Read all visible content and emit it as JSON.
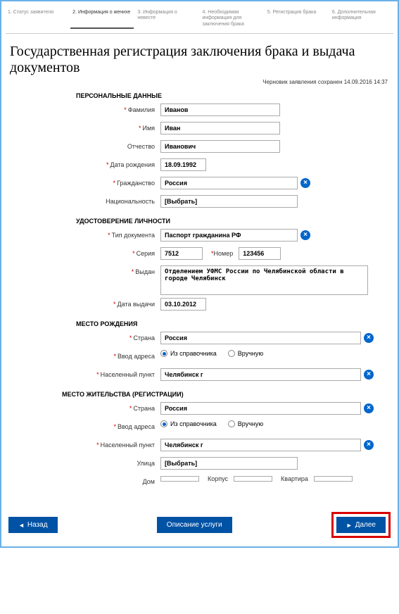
{
  "steps": [
    "1. Статус заявителя",
    "2. Информация о женихе",
    "3. Информация о невесте",
    "4. Необходимая информация для заключения брака",
    "5. Регистрация брака",
    "6. Дополнительная информация"
  ],
  "title": "Государственная регистрация заключения брака и выдача документов",
  "saved": "Черновик заявления сохранен 14.09.2016 14:37",
  "sections": {
    "personal": "ПЕРСОНАЛЬНЫЕ ДАННЫЕ",
    "identity": "УДОСТОВЕРЕНИЕ ЛИЧНОСТИ",
    "birthplace": "МЕСТО РОЖДЕНИЯ",
    "residence": "МЕСТО ЖИТЕЛЬСТВА (РЕГИСТРАЦИИ)"
  },
  "labels": {
    "lastname": "Фамилия",
    "firstname": "Имя",
    "patronymic": "Отчество",
    "birthdate": "Дата рождения",
    "citizenship": "Гражданство",
    "nationality": "Национальность",
    "doctype": "Тип документа",
    "series": "Серия",
    "number": "Номер",
    "issued": "Выдан",
    "issuedate": "Дата выдачи",
    "country": "Страна",
    "addrmode": "Ввод адреса",
    "locality": "Населенный пункт",
    "street": "Улица",
    "house": "Дом",
    "building": "Корпус",
    "apartment": "Квартира"
  },
  "values": {
    "lastname": "Иванов",
    "firstname": "Иван",
    "patronymic": "Иванович",
    "birthdate": "18.09.1992",
    "citizenship": "Россия",
    "nationality": "[Выбрать]",
    "doctype": "Паспорт гражданина РФ",
    "series": "7512",
    "number": "123456",
    "issued": "Отделением УФМС России по Челябинской области в городе Челябинск",
    "issuedate": "03.10.2012",
    "birth_country": "Россия",
    "birth_locality": "Челябинск г",
    "res_country": "Россия",
    "res_locality": "Челябинск г",
    "res_street": "[Выбрать]"
  },
  "radio": {
    "directory": "Из справочника",
    "manual": "Вручную"
  },
  "buttons": {
    "back": "Назад",
    "desc": "Описание услуги",
    "next": "Далее"
  }
}
